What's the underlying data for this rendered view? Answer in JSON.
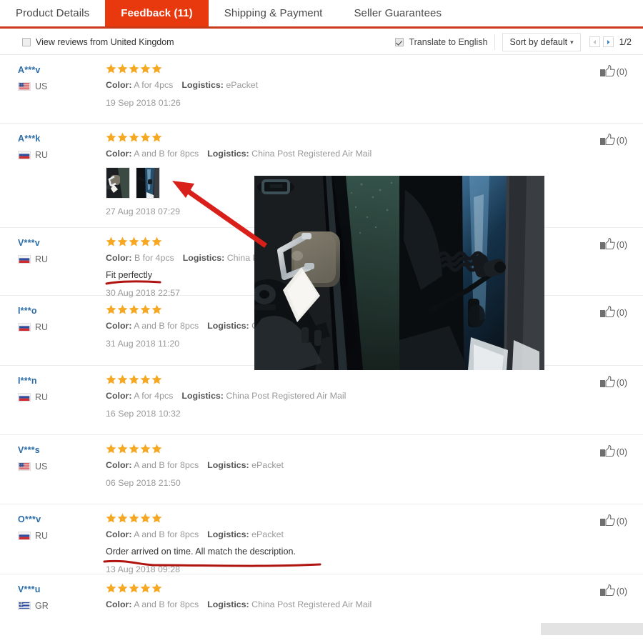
{
  "tabs": [
    {
      "label": "Product Details",
      "active": false
    },
    {
      "label": "Feedback (11)",
      "active": true
    },
    {
      "label": "Shipping & Payment",
      "active": false
    },
    {
      "label": "Seller Guarantees",
      "active": false
    }
  ],
  "toolbar": {
    "view_reviews_label": "View reviews from United Kingdom",
    "view_reviews_checked": false,
    "translate_label": "Translate to English",
    "translate_checked": true,
    "sort_label": "Sort by default",
    "sort_caret": "chevron-down",
    "page_indicator": "1/2"
  },
  "colors": {
    "tab_active_bg": "#e8380d",
    "tab_underline": "#c9391a",
    "star": "#f7a823",
    "username": "#2c6ca6",
    "annotation_red": "#d81f19"
  },
  "reviews": [
    {
      "user": "A***v",
      "country": "US",
      "flag": "us",
      "stars": 5,
      "color_label": "Color:",
      "color_value": "A for 4pcs",
      "logistics_label": "Logistics:",
      "logistics_value": "ePacket",
      "comment": "",
      "date": "19 Sep 2018 01:26",
      "helpful": "(0)",
      "thumbs": 0
    },
    {
      "user": "A***k",
      "country": "RU",
      "flag": "ru",
      "stars": 5,
      "color_label": "Color:",
      "color_value": "A and B for 8pcs",
      "logistics_label": "Logistics:",
      "logistics_value": "China Post Registered Air Mail",
      "comment": "",
      "date": "27 Aug 2018 07:29",
      "helpful": "(0)",
      "thumbs": 2
    },
    {
      "user": "V***v",
      "country": "RU",
      "flag": "ru",
      "stars": 5,
      "color_label": "Color:",
      "color_value": "B for 4pcs",
      "logistics_label": "Logistics:",
      "logistics_value": "China Post Registered Air Mail",
      "comment": "Fit perfectly",
      "date": "30 Aug 2018 22:57",
      "helpful": "(0)",
      "thumbs": 0
    },
    {
      "user": "I***o",
      "country": "RU",
      "flag": "ru",
      "stars": 5,
      "color_label": "Color:",
      "color_value": "A and B for 8pcs",
      "logistics_label": "Logistics:",
      "logistics_value": "China Post Registered Air Mail",
      "comment": "",
      "date": "31 Aug 2018 11:20",
      "helpful": "(0)",
      "thumbs": 0
    },
    {
      "user": "I***n",
      "country": "RU",
      "flag": "ru",
      "stars": 5,
      "color_label": "Color:",
      "color_value": "A for 4pcs",
      "logistics_label": "Logistics:",
      "logistics_value": "China Post Registered Air Mail",
      "comment": "",
      "date": "16 Sep 2018 10:32",
      "helpful": "(0)",
      "thumbs": 0
    },
    {
      "user": "V***s",
      "country": "US",
      "flag": "us",
      "stars": 5,
      "color_label": "Color:",
      "color_value": "A and B for 8pcs",
      "logistics_label": "Logistics:",
      "logistics_value": "ePacket",
      "comment": "",
      "date": "06 Sep 2018 21:50",
      "helpful": "(0)",
      "thumbs": 0
    },
    {
      "user": "O***v",
      "country": "RU",
      "flag": "ru",
      "stars": 5,
      "color_label": "Color:",
      "color_value": "A and B for 8pcs",
      "logistics_label": "Logistics:",
      "logistics_value": "ePacket",
      "comment": "Order arrived on time. All match the description.",
      "date": "13 Aug 2018 09:28",
      "helpful": "(0)",
      "thumbs": 0
    },
    {
      "user": "V***u",
      "country": "GR",
      "flag": "gr",
      "stars": 5,
      "color_label": "Color:",
      "color_value": "A and B for 8pcs",
      "logistics_label": "Logistics:",
      "logistics_value": "China Post Registered Air Mail",
      "comment": "",
      "date": "",
      "helpful": "(0)",
      "thumbs": 0
    }
  ],
  "photo_overlay": {
    "name": "review-photo-preview",
    "left_photo_alt": "car door latch striker with metal bracket",
    "right_photo_alt": "car door hinge with check strap"
  },
  "annotations": [
    {
      "type": "arrow",
      "name": "red-arrow-to-thumbnails"
    },
    {
      "type": "underline",
      "name": "red-underline-fit-perfectly"
    },
    {
      "type": "underline",
      "name": "red-underline-order-arrived"
    }
  ]
}
